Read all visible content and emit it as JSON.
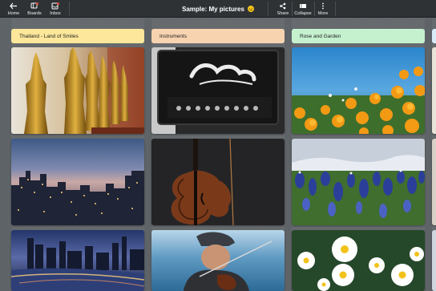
{
  "toolbar": {
    "home_label": "Home",
    "boards_label": "Boards",
    "inbox_label": "Inbox",
    "share_label": "Share",
    "collapse_label": "Collapse",
    "more_label": "More"
  },
  "board": {
    "title": "Sample: My pictures"
  },
  "columns": [
    {
      "header": "Thailand - Land of Smiles",
      "header_color": "#fde79a",
      "cards": [
        "golden-buddha-statues-photo",
        "city-skyline-dusk-photo",
        "city-night-river-photo"
      ]
    },
    {
      "header": "Instruments",
      "header_color": "#f7d3b0",
      "cards": [
        "guitar-amplifier-photo",
        "violin-photo",
        "violinist-photo"
      ]
    },
    {
      "header": "Rose and Garden",
      "header_color": "#c5f1cf",
      "cards": [
        "orange-poppies-photo",
        "bluebonnet-field-photo",
        "white-daisies-photo"
      ]
    }
  ],
  "colors": {
    "toolbar_bg": "#2f3235",
    "board_bg": "#5f6468",
    "next_column_header": "#d8ecf8"
  }
}
